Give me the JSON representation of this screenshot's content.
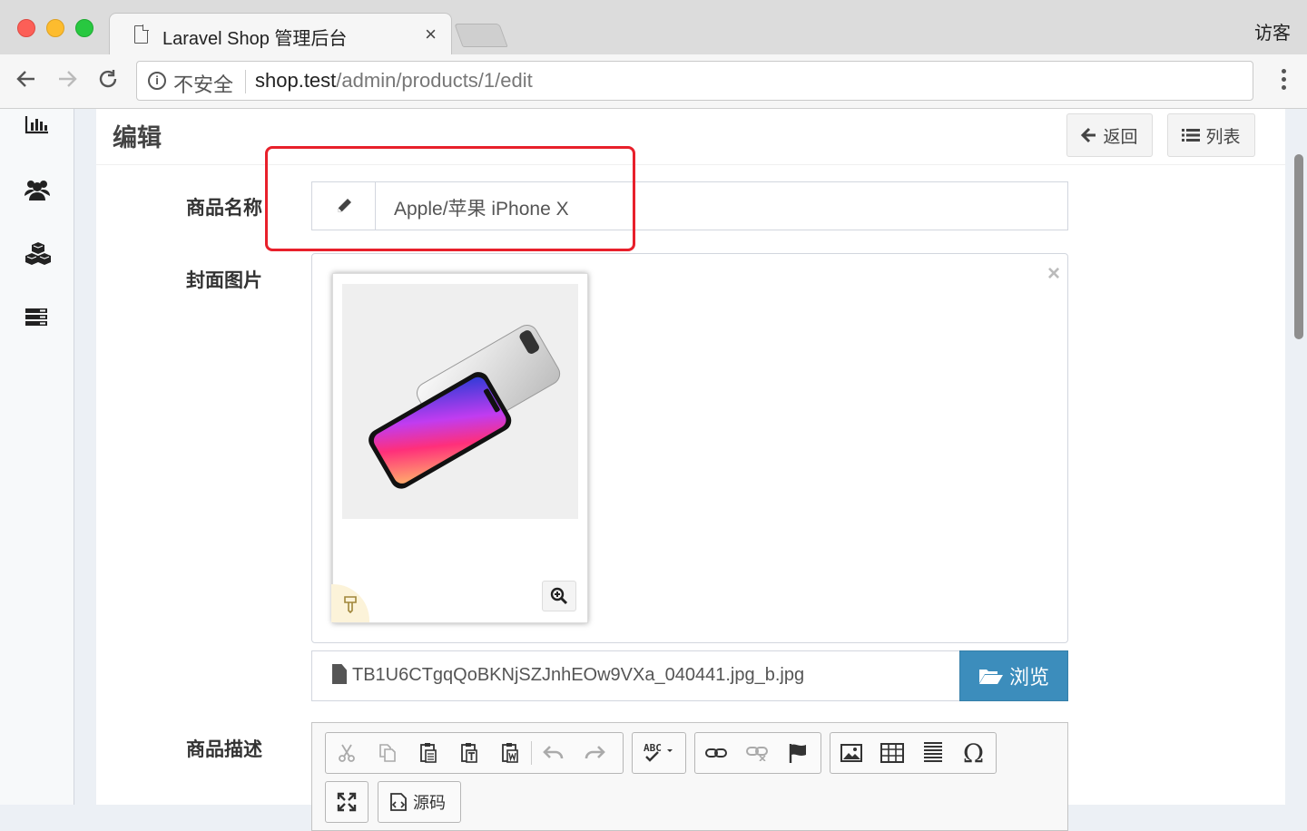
{
  "browser": {
    "tab_title": "Laravel Shop 管理后台",
    "tab_close": "×",
    "profile_label": "访客",
    "security_label": "不安全",
    "url_host": "shop.test",
    "url_path": "/admin/products/1/edit"
  },
  "sidebar": {
    "items": [
      {
        "icon": "bar-chart-icon"
      },
      {
        "icon": "users-icon"
      },
      {
        "icon": "cubes-icon"
      },
      {
        "icon": "server-icon"
      }
    ]
  },
  "header": {
    "title": "编辑",
    "back_label": "返回",
    "list_label": "列表"
  },
  "form": {
    "name_label": "商品名称",
    "name_value": "Apple/苹果 iPhone X",
    "cover_label": "封面图片",
    "preview_close": "×",
    "file_name": "TB1U6CTgqQoBKNjSZJnhEOw9VXa_040441.jpg_b.jpg",
    "browse_label": "浏览",
    "description_label": "商品描述",
    "source_label": "源码"
  },
  "colors": {
    "accent": "#3c8dbc",
    "highlight": "#e8202b"
  }
}
